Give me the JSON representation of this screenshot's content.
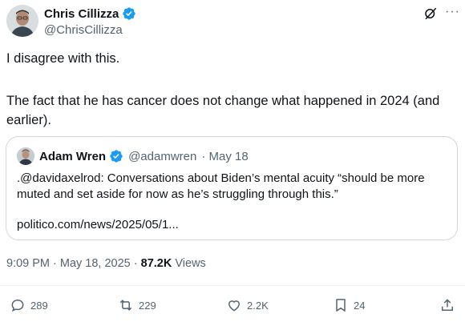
{
  "author": {
    "name": "Chris Cillizza",
    "handle": "@ChrisCillizza"
  },
  "tweet": {
    "line1": "I disagree with this.",
    "line2": "The fact that he has cancer does not change what happened in 2024 (and earlier)."
  },
  "quoted": {
    "name": "Adam Wren",
    "handle": "@adamwren",
    "date": "· May 18",
    "text": ".@davidaxelrod: Conversations about Biden’s mental acuity “should be more muted and set aside for now as he’s struggling through this.”",
    "link": "politico.com/news/2025/05/1..."
  },
  "meta": {
    "time": "9:09 PM · May 18, 2025 · ",
    "views_count": "87.2K",
    "views_label": " Views"
  },
  "actions": {
    "replies": "289",
    "reposts": "229",
    "likes": "2.2K",
    "bookmarks": "24"
  },
  "colors": {
    "verified": "#1d9bf0",
    "text": "#0f1419",
    "muted": "#536471",
    "border": "#cfd9de"
  },
  "icons": [
    "verified-badge-icon",
    "grok-icon",
    "more-icon",
    "reply-icon",
    "repost-icon",
    "like-icon",
    "bookmark-icon",
    "share-icon"
  ]
}
